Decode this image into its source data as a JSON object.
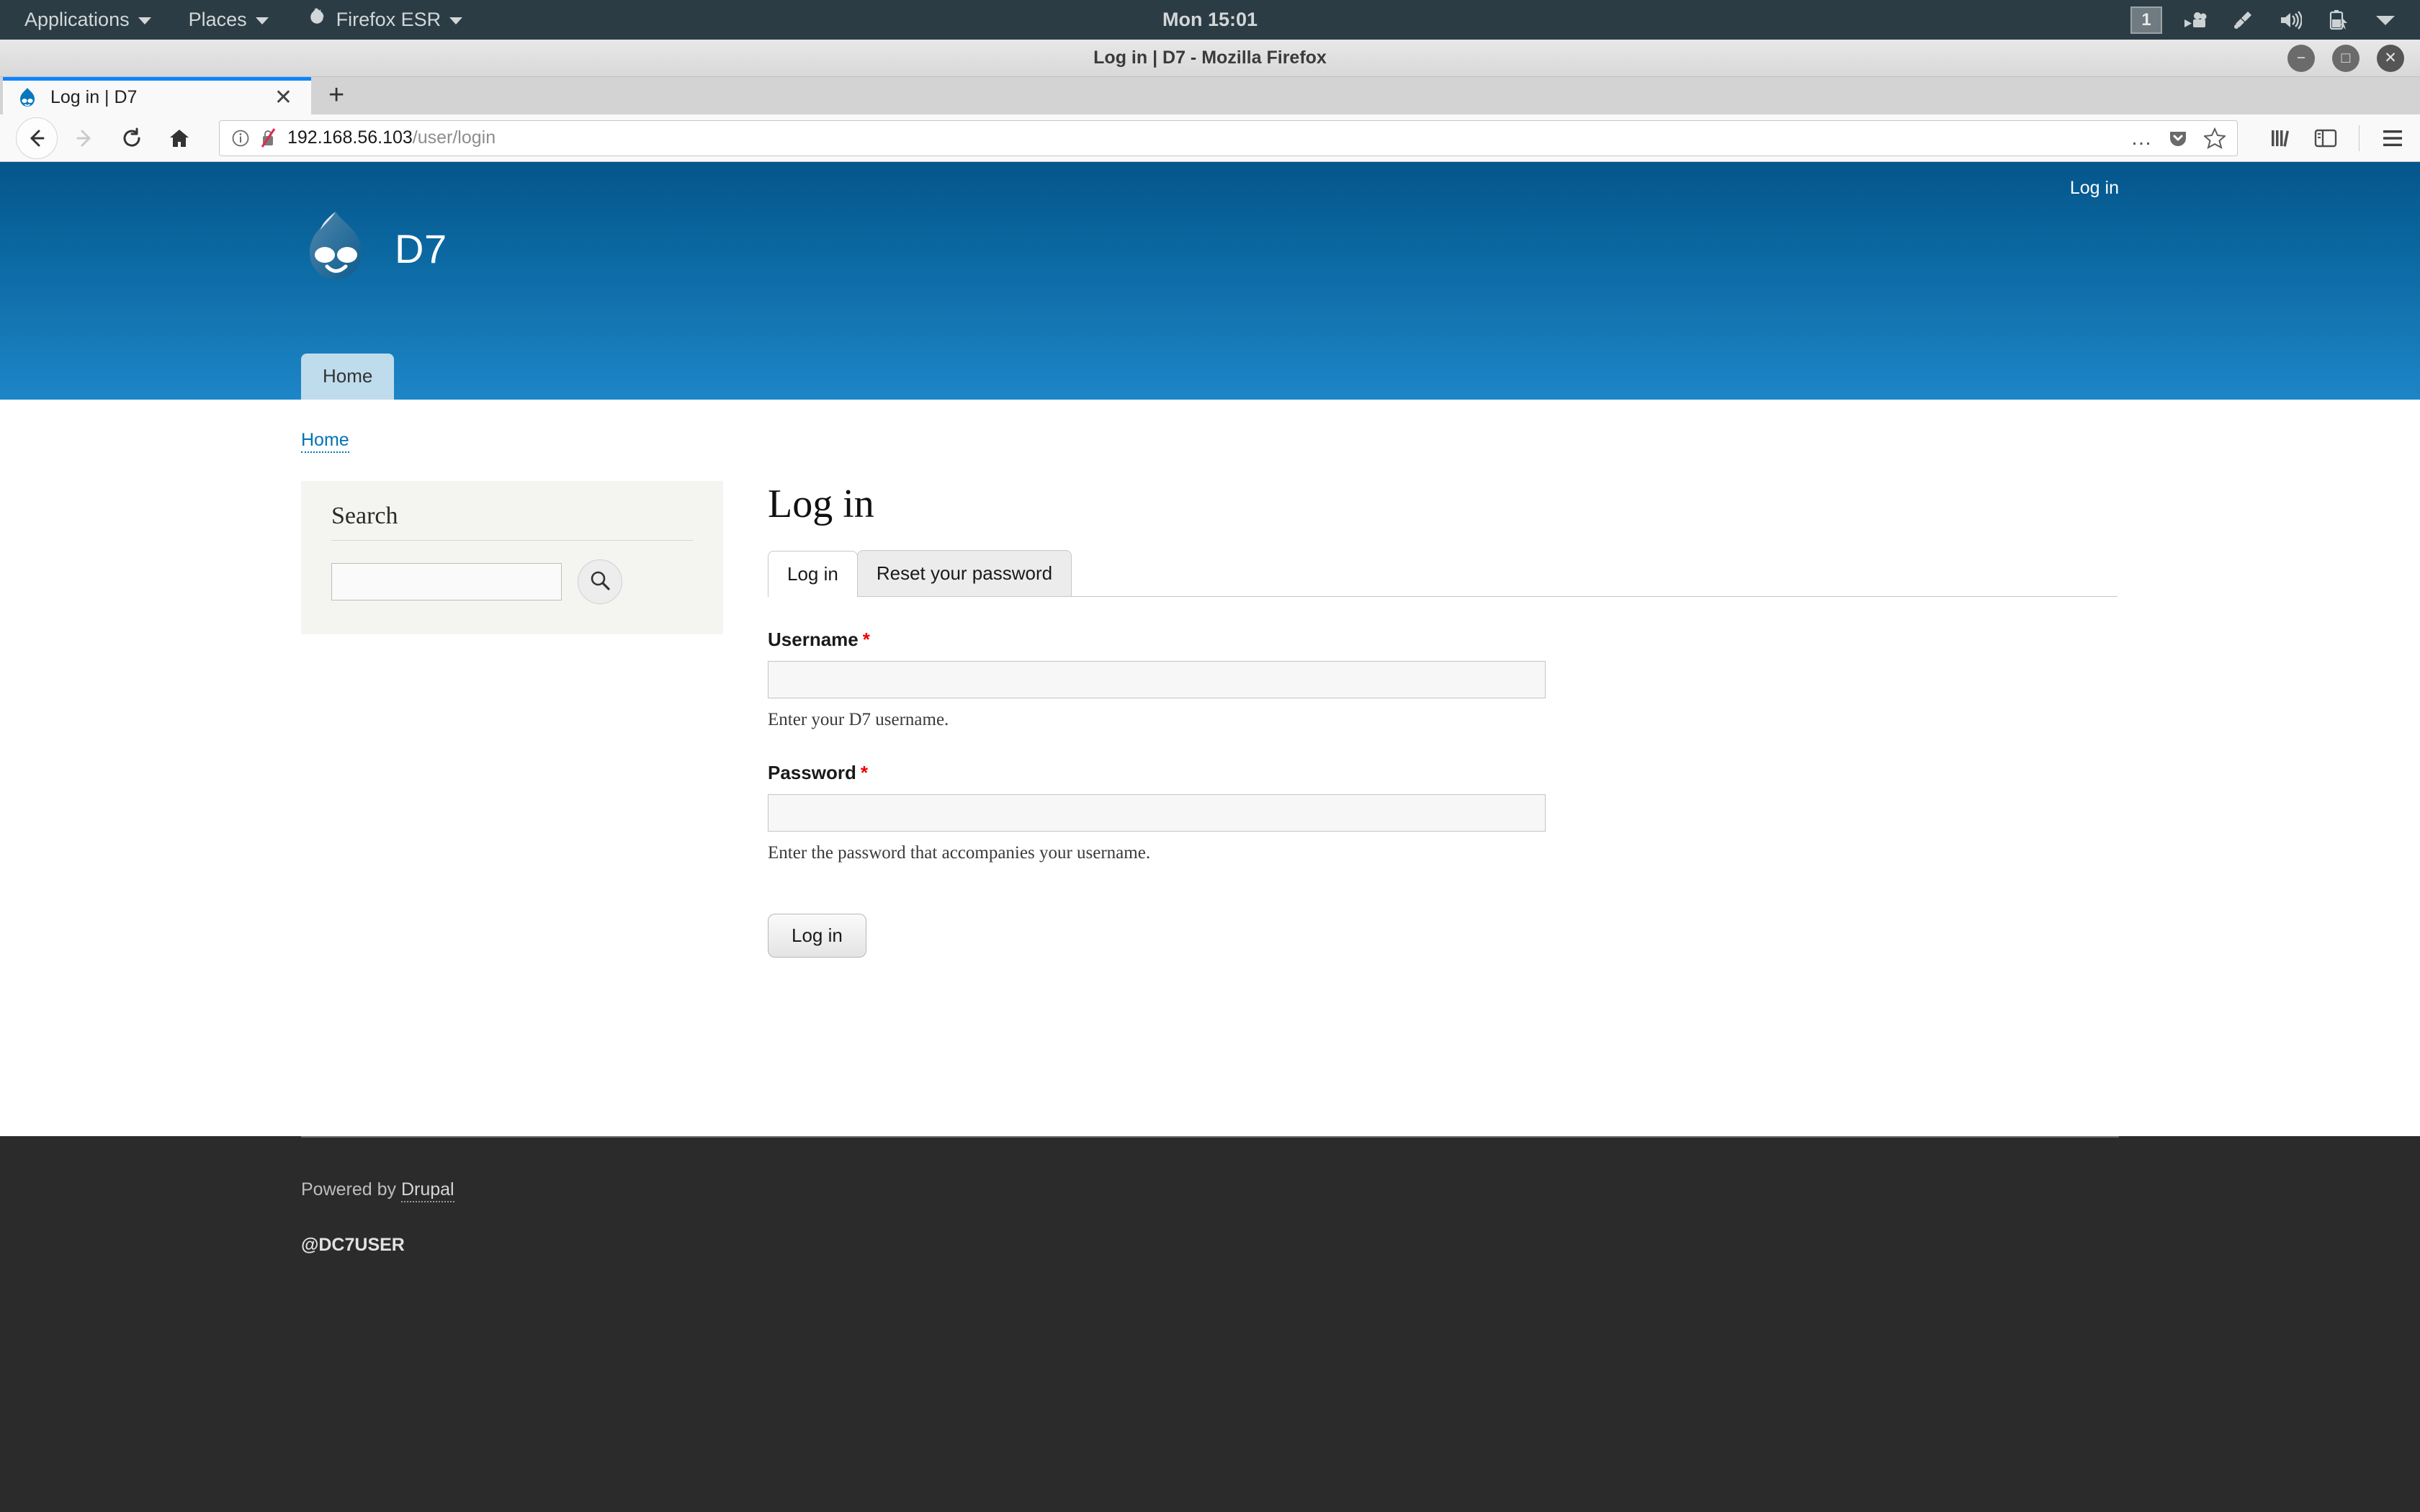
{
  "desktop": {
    "menus": [
      {
        "label": "Applications",
        "icon": null
      },
      {
        "label": "Places",
        "icon": null
      },
      {
        "label": "Firefox ESR",
        "icon": "firefox-icon"
      }
    ],
    "clock": "Mon 15:01",
    "workspace": "1",
    "tray_icons": [
      "video-camera-icon",
      "network-tool-icon",
      "volume-icon",
      "battery-icon",
      "chevron-down-icon"
    ]
  },
  "browser": {
    "window_title": "Log in | D7 - Mozilla Firefox",
    "window_controls": {
      "minimize": "−",
      "maximize": "□",
      "close": "✕"
    },
    "tab": {
      "title": "Log in | D7",
      "favicon": "drupal-droplet-icon",
      "close": "✕"
    },
    "new_tab": "+",
    "nav": {
      "back": "back-icon",
      "forward": "forward-icon",
      "reload": "reload-icon",
      "home": "home-icon"
    },
    "urlbar": {
      "identity_icon": "info-circle-icon",
      "security_icon": "broken-lock-icon",
      "host": "192.168.56.103",
      "path": "/user/login",
      "page_actions": "…",
      "pocket": "pocket-icon",
      "bookmark": "star-icon"
    },
    "toolbar_right": {
      "library": "library-icon",
      "sidebar": "sidebar-icon",
      "menu": "hamburger-menu-icon"
    }
  },
  "site": {
    "header": {
      "login_link": "Log in",
      "site_name": "D7",
      "logo": "drupal-droplet-icon",
      "menu": [
        {
          "label": "Home",
          "active": true
        }
      ]
    },
    "breadcrumb": [
      {
        "label": "Home"
      }
    ],
    "sidebar": {
      "search_block": {
        "title": "Search",
        "input_value": "",
        "submit_icon": "search-icon"
      }
    },
    "content": {
      "title": "Log in",
      "tabs": [
        {
          "label": "Log in",
          "active": true
        },
        {
          "label": "Reset your password",
          "active": false
        }
      ],
      "fields": [
        {
          "label": "Username",
          "required_marker": "*",
          "value": "",
          "description": "Enter your D7 username."
        },
        {
          "label": "Password",
          "required_marker": "*",
          "value": "",
          "description": "Enter the password that accompanies your username."
        }
      ],
      "submit_label": "Log in"
    },
    "footer": {
      "powered_prefix": "Powered by ",
      "powered_link": "Drupal",
      "user_tag": "@DC7USER"
    }
  },
  "colors": {
    "header_blue_top": "#04568b",
    "header_blue_bottom": "#1d86c8",
    "link_blue": "#0073b6",
    "required_red": "#ee0000",
    "footer_dark": "#2b2b2b",
    "panel_dark": "#2b3c45",
    "tab_accent": "#0a84ff"
  }
}
